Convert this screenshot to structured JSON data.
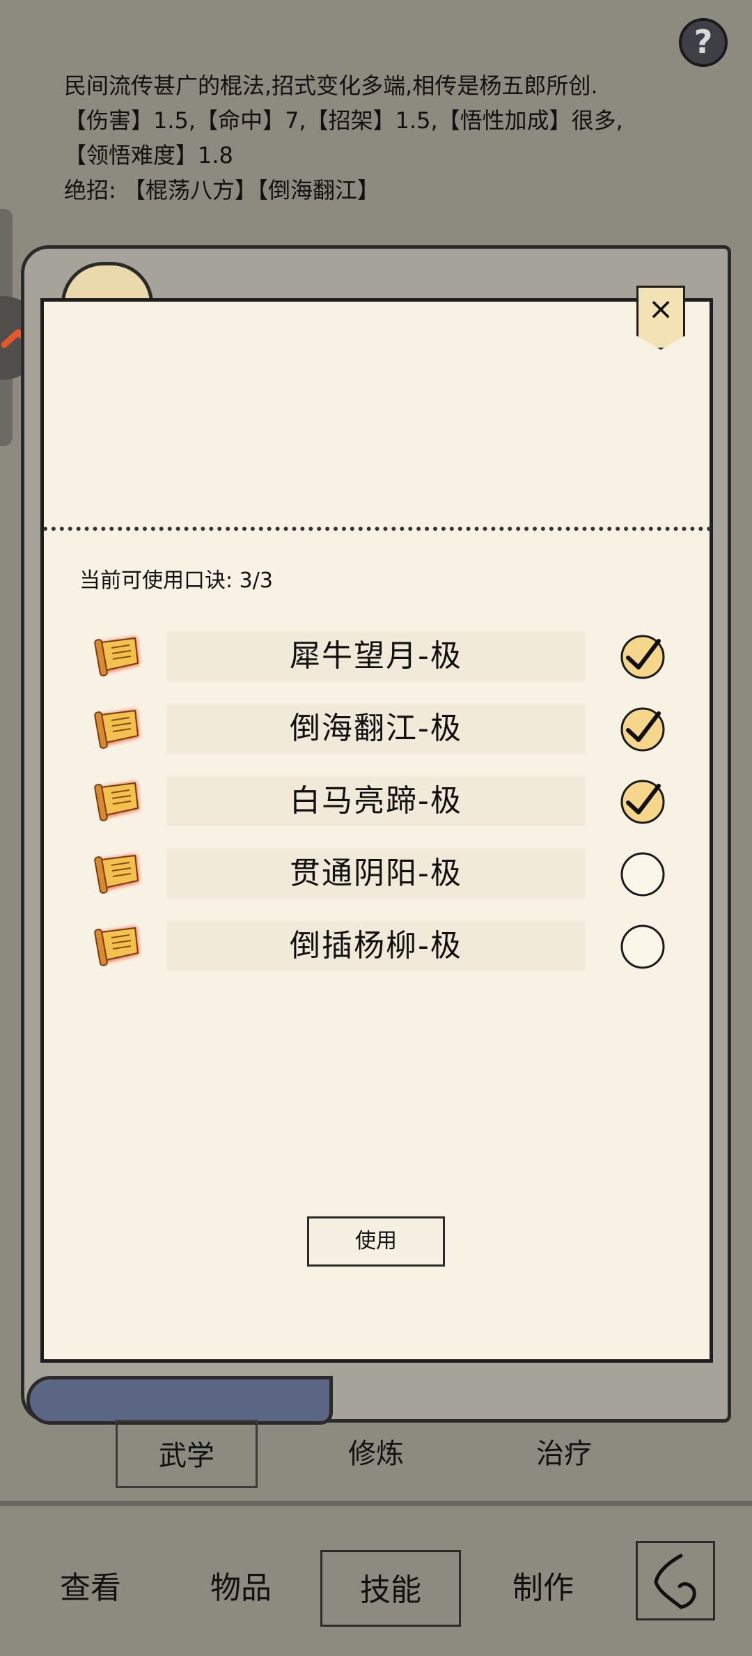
{
  "help_button": {
    "label": "?"
  },
  "description": {
    "line1": "民间流传甚广的棍法,招式变化多端,相传是杨五郎所创.",
    "line2": "【伤害】1.5,【命中】7,【招架】1.5,【悟性加成】很多,",
    "line3": "【领悟难度】1.8",
    "line4": "绝招: 【棍荡八方】【倒海翻江】"
  },
  "panel": {
    "close_label": "×",
    "count_label": "当前可使用口诀: 3/3",
    "skills": [
      {
        "name": "犀牛望月-极",
        "checked": true
      },
      {
        "name": "倒海翻江-极",
        "checked": true
      },
      {
        "name": "白马亮蹄-极",
        "checked": true
      },
      {
        "name": "贯通阴阳-极",
        "checked": false
      },
      {
        "name": "倒插杨柳-极",
        "checked": false
      }
    ],
    "use_button": "使用"
  },
  "categories": {
    "martial": "武学",
    "cultivate": "修炼",
    "heal": "治疗"
  },
  "bottom_nav": {
    "view": "查看",
    "items": "物品",
    "skills": "技能",
    "craft": "制作"
  },
  "colors": {
    "background": "#8d8a80",
    "panel": "#f8f2e4",
    "scroll_roll": "#5b6584",
    "icon_gold": "#f2c14e",
    "icon_glow": "#e8431c"
  }
}
